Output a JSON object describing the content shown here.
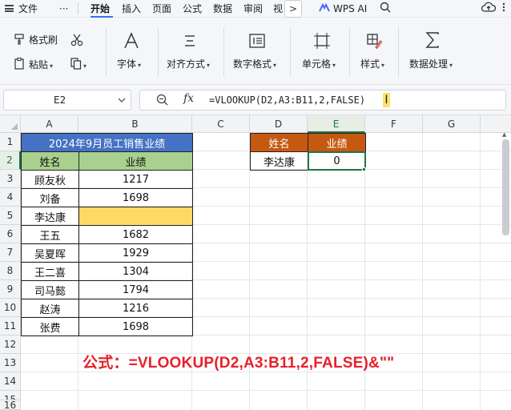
{
  "menubar": {
    "file": "文件",
    "more_dots": "···",
    "tabs": [
      "开始",
      "插入",
      "页面",
      "公式",
      "数据",
      "审阅",
      "视"
    ],
    "overflow": ">",
    "wps_ai": "WPS AI"
  },
  "ribbon": {
    "format_painter": "格式刷",
    "paste": "粘贴",
    "font": "字体",
    "align": "对齐方式",
    "number_format": "数字格式",
    "cell": "单元格",
    "style": "样式",
    "data_processing": "数据处理",
    "caret": "▾"
  },
  "formula_bar": {
    "name_box": "E2",
    "fx": "fx",
    "formula": "=VLOOKUP(D2,A3:B11,2,FALSE)",
    "cursor": "I"
  },
  "sheet": {
    "columns": [
      "A",
      "B",
      "C",
      "D",
      "E",
      "F",
      "G"
    ],
    "rows": [
      "1",
      "2",
      "3",
      "4",
      "5",
      "6",
      "7",
      "8",
      "9",
      "10",
      "11",
      "12",
      "13",
      "14",
      "15",
      "16"
    ],
    "title": "2024年9月员工销售业绩",
    "header_name": "姓名",
    "header_perf": "业绩",
    "records": [
      {
        "name": "顾友秋",
        "perf": "1217"
      },
      {
        "name": "刘备",
        "perf": "1698"
      },
      {
        "name": "李达康",
        "perf": ""
      },
      {
        "name": "王五",
        "perf": "1682"
      },
      {
        "name": "吴夏晖",
        "perf": "1929"
      },
      {
        "name": "王二喜",
        "perf": "1304"
      },
      {
        "name": "司马懿",
        "perf": "1794"
      },
      {
        "name": "赵涛",
        "perf": "1216"
      },
      {
        "name": "张费",
        "perf": "1698"
      }
    ],
    "lookup": {
      "header_name": "姓名",
      "header_perf": "业绩",
      "name": "李达康",
      "result": "0"
    }
  },
  "annotation": "公式：=VLOOKUP(D2,A3:B11,2,FALSE)&\"\"",
  "colors": {
    "title_bg": "#4472c4",
    "header_green": "#a9d08e",
    "header_orange": "#c65911",
    "highlight_yellow": "#ffd966",
    "active_border": "#217346",
    "annotation_red": "#e8202a",
    "tab_accent": "#3b6ef5"
  }
}
